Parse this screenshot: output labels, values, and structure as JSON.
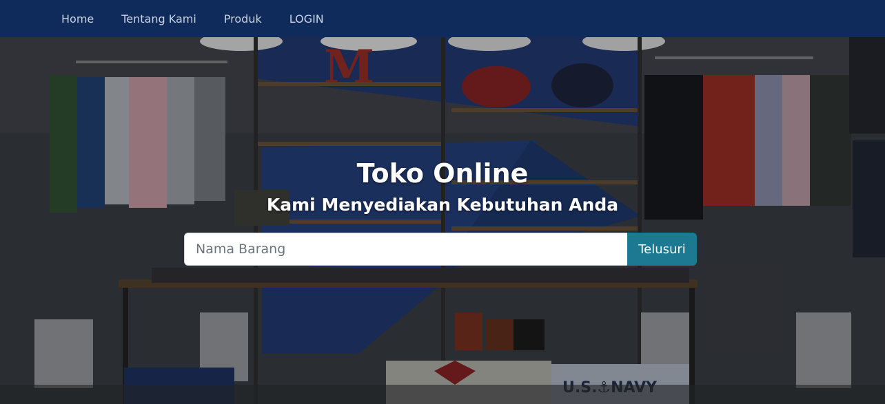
{
  "navbar": {
    "items": [
      {
        "label": "Home"
      },
      {
        "label": "Tentang Kami"
      },
      {
        "label": "Produk"
      },
      {
        "label": "LOGIN"
      }
    ]
  },
  "hero": {
    "title": "Toko Online",
    "subtitle": "Kami Menyediakan Kebutuhan Anda",
    "search": {
      "placeholder": "Nama Barang",
      "value": "",
      "button_label": "Telusuri"
    }
  },
  "colors": {
    "navbar_bg": "#0f2b5b",
    "button_bg": "#1d7892"
  }
}
